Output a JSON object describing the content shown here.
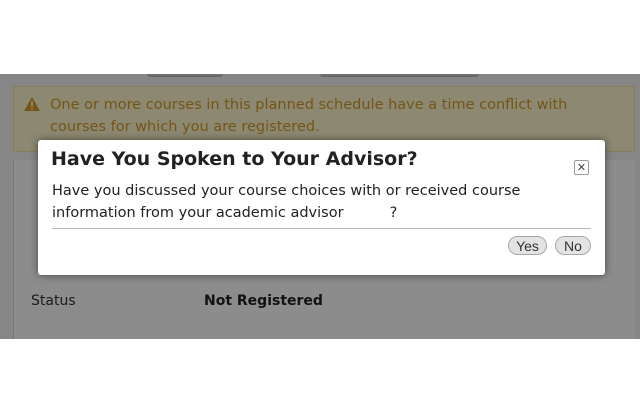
{
  "warning": {
    "icon": "warning-triangle-icon",
    "icon_color": "#d59b27",
    "text": "One or more courses in this planned schedule have a time conflict with courses for which you are registered."
  },
  "details": {
    "status_label": "Status",
    "status_value": "Not Registered"
  },
  "dialog": {
    "title": "Have You Spoken to Your Advisor?",
    "close_icon": "close-icon",
    "message": "Have you discussed your course choices with or received course information from your academic advisor          ?",
    "yes_label": "Yes",
    "no_label": "No"
  }
}
